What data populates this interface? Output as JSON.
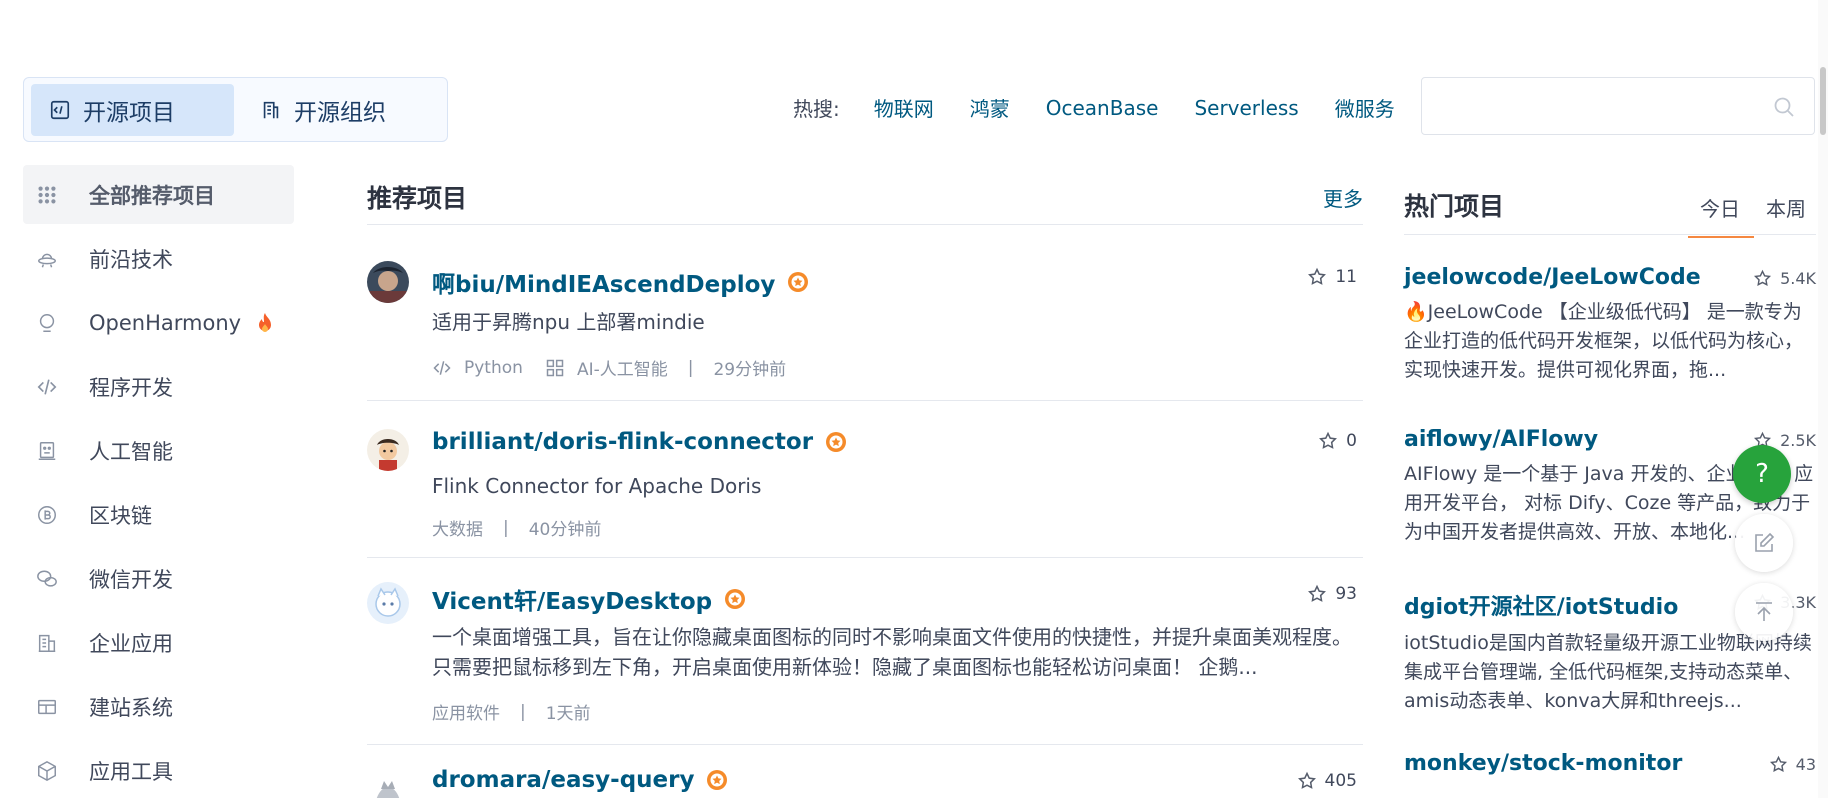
{
  "type_tabs": [
    {
      "label": "开源项目",
      "active": true
    },
    {
      "label": "开源组织",
      "active": false
    }
  ],
  "hot_search": {
    "label": "热搜:",
    "terms": [
      "物联网",
      "鸿蒙",
      "OceanBase",
      "Serverless",
      "微服务"
    ]
  },
  "search": {
    "placeholder": "",
    "value": ""
  },
  "sidebar": {
    "items": [
      {
        "label": "全部推荐项目",
        "icon": "grid-icon",
        "active": true
      },
      {
        "label": "前沿技术",
        "icon": "ufo-icon"
      },
      {
        "label": "OpenHarmony",
        "icon": "bulb-icon",
        "hot": true
      },
      {
        "label": "程序开发",
        "icon": "code-icon"
      },
      {
        "label": "人工智能",
        "icon": "robot-icon"
      },
      {
        "label": "区块链",
        "icon": "coin-icon"
      },
      {
        "label": "微信开发",
        "icon": "wechat-icon"
      },
      {
        "label": "企业应用",
        "icon": "building-icon"
      },
      {
        "label": "建站系统",
        "icon": "layout-icon"
      },
      {
        "label": "应用工具",
        "icon": "cube-icon"
      }
    ]
  },
  "main": {
    "title": "推荐项目",
    "more_label": "更多",
    "projects": [
      {
        "name": "啊biu/MindIEAscendDeploy",
        "stars": "11",
        "desc": "适用于昇腾npu 上部署mindie",
        "language": "Python",
        "category": "AI-人工智能",
        "separator": "|",
        "time": "29分钟前"
      },
      {
        "name": "brilliant/doris-flink-connector",
        "stars": "0",
        "desc": "Flink Connector for Apache Doris",
        "category": "大数据",
        "separator": "|",
        "time": "40分钟前"
      },
      {
        "name": "Vicent轩/EasyDesktop",
        "stars": "93",
        "desc": "一个桌面增强工具，旨在让你隐藏桌面图标的同时不影响桌面文件使用的快捷性，并提升桌面美观程度。只需要把鼠标移到左下角，开启桌面使用新体验！隐藏了桌面图标也能轻松访问桌面！ 企鹅...",
        "category": "应用软件",
        "separator": "|",
        "time": "1天前"
      },
      {
        "name": "dromara/easy-query",
        "stars": "405"
      }
    ]
  },
  "right": {
    "title": "热门项目",
    "tabs": [
      {
        "label": "今日",
        "active": true
      },
      {
        "label": "本周",
        "active": false
      }
    ],
    "projects": [
      {
        "name": "jeelowcode/JeeLowCode",
        "stars": "5.4K",
        "desc": "🔥JeeLowCode 【企业级低代码】 是一款专为企业打造的低代码开发框架，以低代码为核心，实现快速开发。提供可视化界面，拖..."
      },
      {
        "name": "aiflowy/AIFlowy",
        "stars": "2.5K",
        "desc": "AIFlowy 是一个基于 Java 开发的、企业级 AI 应用开发平台， 对标 Dify、Coze 等产品，致力于为中国开发者提供高效、开放、本地化..."
      },
      {
        "name": "dgiot开源社区/iotStudio",
        "stars": "3.3K",
        "desc": "iotStudio是国内首款轻量级开源工业物联网持续集成平台管理端, 全低代码框架,支持动态菜单、amis动态表单、konva大屏和threejs..."
      },
      {
        "name": "monkey/stock-monitor",
        "stars": "43"
      }
    ]
  },
  "floating": {
    "help_label": "?"
  },
  "colors": {
    "link": "#005980",
    "accent": "#f58840",
    "help": "#27a33c",
    "badge": "#f58b2a"
  }
}
